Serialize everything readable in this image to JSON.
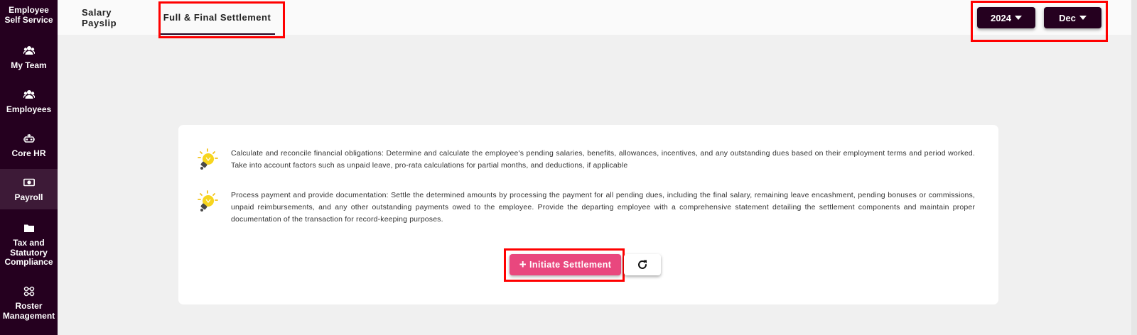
{
  "sidebar": {
    "items": [
      {
        "label": "Employee Self Service",
        "icon": "employee-self-service-icon"
      },
      {
        "label": "My Team",
        "icon": "team-icon"
      },
      {
        "label": "Employees",
        "icon": "employees-icon"
      },
      {
        "label": "Core HR",
        "icon": "core-hr-icon"
      },
      {
        "label": "Payroll",
        "icon": "money-icon"
      },
      {
        "label": "Tax and Statutory Compliance",
        "icon": "folder-icon"
      },
      {
        "label": "Roster Management",
        "icon": "roster-icon"
      }
    ],
    "active": "Payroll"
  },
  "tabs": [
    {
      "label": "Salary Payslip"
    },
    {
      "label": "Full & Final Settlement"
    }
  ],
  "active_tab": "Full & Final Settlement",
  "filters": {
    "year": "2024",
    "month": "Dec"
  },
  "settlement": {
    "tips": [
      "Calculate and reconcile financial obligations: Determine and calculate the employee's pending salaries, benefits, allowances, incentives, and any outstanding dues based on their employment terms and period worked. Take into account factors such as unpaid leave, pro-rata calculations for partial months, and deductions, if applicable",
      "Process payment and provide documentation: Settle the determined amounts by processing the payment for all pending dues, including the final salary, remaining leave encashment, pending bonuses or commissions, unpaid reimbursements, and any other outstanding payments owed to the employee. Provide the departing employee with a comprehensive statement detailing the settlement components and maintain proper documentation of the transaction for record-keeping purposes."
    ],
    "initiate_label": "Initiate Settlement",
    "initiate_icon": "plus-icon",
    "refresh_icon": "refresh-icon"
  },
  "colors": {
    "sidebar_bg": "#25001f",
    "sidebar_active": "#3d1a37",
    "accent_pink": "#e9477e",
    "highlight": "#ff0000"
  }
}
